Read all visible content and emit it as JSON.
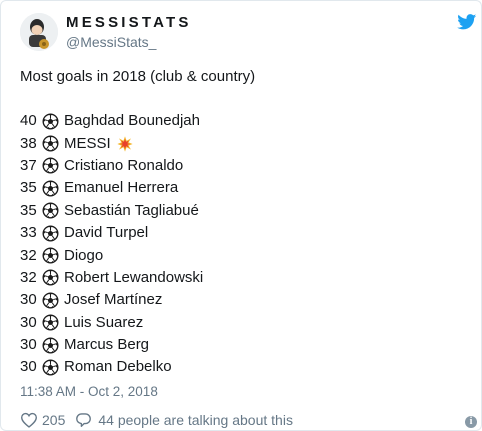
{
  "author": {
    "name": "MESSISTATS",
    "handle": "@MessiStats_"
  },
  "headline": "Most goals in 2018 (club & country)",
  "goal_list": [
    {
      "goals": "40",
      "player": "Baghdad Bounedjah"
    },
    {
      "goals": "38",
      "player": "MESSI"
    },
    {
      "goals": "37",
      "player": "Cristiano Ronaldo"
    },
    {
      "goals": "35",
      "player": "Emanuel Herrera"
    },
    {
      "goals": "35",
      "player": "Sebastián Tagliabué"
    },
    {
      "goals": "33",
      "player": "David Turpel"
    },
    {
      "goals": "32",
      "player": "Diogo"
    },
    {
      "goals": "32",
      "player": "Robert Lewandowski"
    },
    {
      "goals": "30",
      "player": "Josef Martínez"
    },
    {
      "goals": "30",
      "player": "Luis Suarez"
    },
    {
      "goals": "30",
      "player": "Marcus Berg"
    },
    {
      "goals": "30",
      "player": "Roman Debelko"
    }
  ],
  "timestamp": "11:38 AM - Oct 2, 2018",
  "footer": {
    "likes": "205",
    "talking": "44 people are talking about this",
    "info": "i"
  },
  "icons": {
    "ball": "soccer-ball-icon",
    "boom": "collision-emoji-icon",
    "bird": "twitter-bird-icon",
    "heart": "heart-icon",
    "reply": "speech-bubble-icon"
  },
  "colors": {
    "twitter_blue": "#1da1f2",
    "muted": "#657786",
    "border": "#e1e8ed"
  }
}
